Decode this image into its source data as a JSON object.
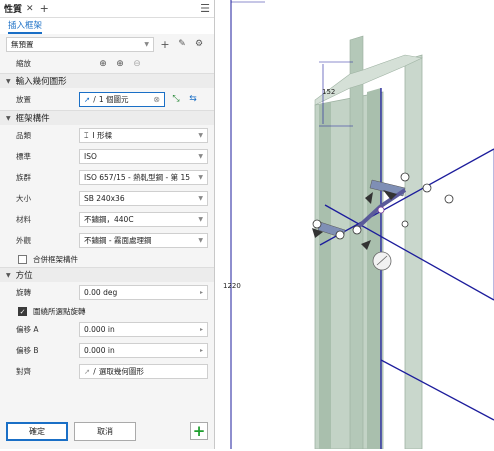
{
  "titlebar": {
    "tab": "性質",
    "close": "✕",
    "add": "+",
    "menu": "☰"
  },
  "subtab": "插入框架",
  "preset": {
    "value": "無預置",
    "add": "+",
    "pin": "✎",
    "gear": "⚙"
  },
  "zoom": {
    "label": "縮放"
  },
  "sections": {
    "geometry": "輸入幾何圖形",
    "frame": "框架構件",
    "orientation": "方位"
  },
  "placement": {
    "label": "放置",
    "value": "1 個圖元",
    "clear": "⊗"
  },
  "frame": {
    "category": {
      "label": "品類",
      "value": "I 形樑"
    },
    "standard": {
      "label": "標準",
      "value": "ISO"
    },
    "family": {
      "label": "族群",
      "value": "ISO 657/15 - 熱軋型鋼 - 第 15"
    },
    "size": {
      "label": "大小",
      "value": "SB 240x36"
    },
    "material": {
      "label": "材料",
      "value": "不鏽鋼，440C"
    },
    "appearance": {
      "label": "外觀",
      "value": "不鏽鋼 - 霧面處理鋼"
    },
    "merge": "合併框架構件"
  },
  "orientation": {
    "rotation": {
      "label": "旋轉",
      "value": "0.00 deg"
    },
    "rotate_around": "圍繞所選點旋轉",
    "offset_a": {
      "label": "偏移 A",
      "value": "0.000 in"
    },
    "offset_b": {
      "label": "偏移 B",
      "value": "0.000 in"
    },
    "align": {
      "label": "對齊",
      "value": "選取幾何圖形"
    }
  },
  "buttons": {
    "ok": "確定",
    "cancel": "取消",
    "add": "+"
  },
  "viewport": {
    "dim_top": "152",
    "dim_height": "1220"
  },
  "colors": {
    "accent": "#1a6fc6",
    "add_green": "#1e9e2e",
    "beam": "#b9cbbd",
    "sketch": "#1c1c9c"
  }
}
